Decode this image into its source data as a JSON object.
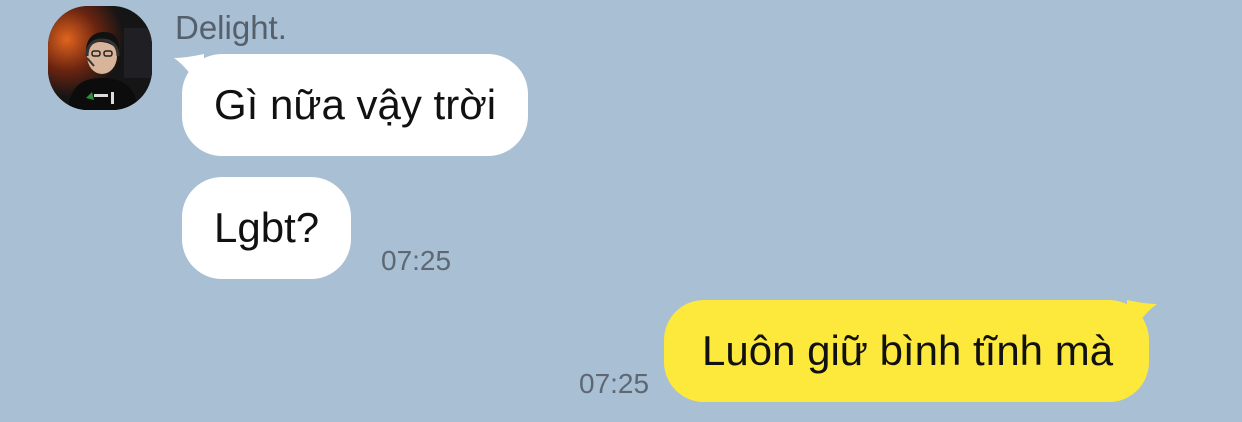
{
  "contact": {
    "name": "Delight.",
    "avatar_icon": "profile-photo"
  },
  "messages": [
    {
      "direction": "incoming",
      "text": "Gì nữa vậy trời",
      "time": ""
    },
    {
      "direction": "incoming",
      "text": "Lgbt?",
      "time": "07:25"
    },
    {
      "direction": "outgoing",
      "text": "Luôn giữ bình tĩnh mà",
      "time": "07:25"
    }
  ],
  "colors": {
    "background": "#a9bfd3",
    "incoming_bubble": "#ffffff",
    "outgoing_bubble": "#fde93c",
    "timestamp": "#5d6874",
    "sender_name": "#55606c"
  }
}
